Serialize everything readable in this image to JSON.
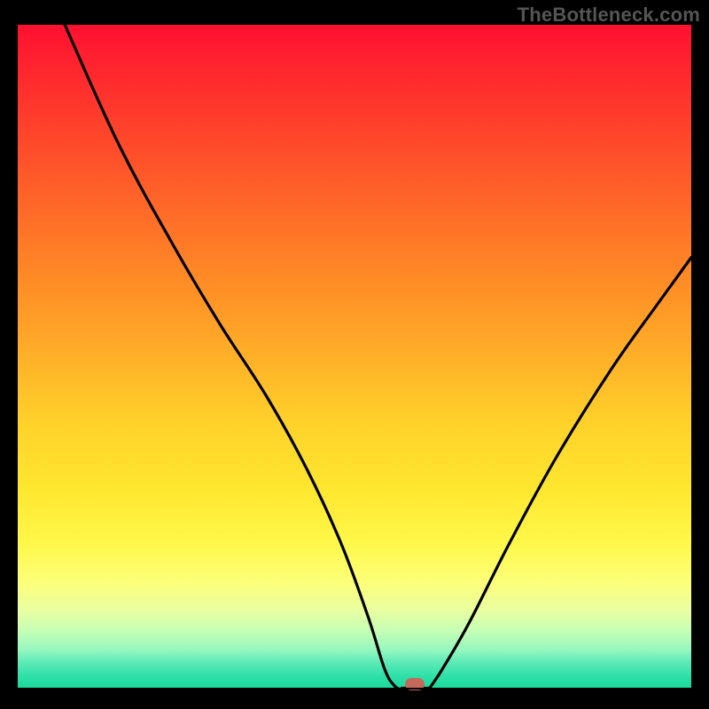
{
  "watermark": "TheBottleneck.com",
  "colors": {
    "frame": "#000000",
    "curve": "#000000",
    "marker": "#c46a5c",
    "gradient_top": "#ff1030",
    "gradient_bottom": "#18d99a"
  },
  "chart_data": {
    "type": "line",
    "title": "",
    "xlabel": "",
    "ylabel": "",
    "xlim": [
      0,
      100
    ],
    "ylim": [
      0,
      100
    ],
    "grid": false,
    "series": [
      {
        "name": "left-branch",
        "x": [
          7,
          15,
          23,
          30,
          37,
          43,
          48,
          52,
          54.5,
          56,
          57
        ],
        "y": [
          100,
          82,
          67,
          55,
          44,
          33,
          22,
          11,
          3,
          0.5,
          0
        ]
      },
      {
        "name": "right-branch",
        "x": [
          61,
          63,
          67,
          73,
          80,
          88,
          95,
          100
        ],
        "y": [
          0,
          3,
          10,
          22,
          35,
          48,
          58,
          65
        ]
      }
    ],
    "annotations": [
      {
        "name": "minimum-marker",
        "x": 59,
        "y": 0
      }
    ]
  }
}
